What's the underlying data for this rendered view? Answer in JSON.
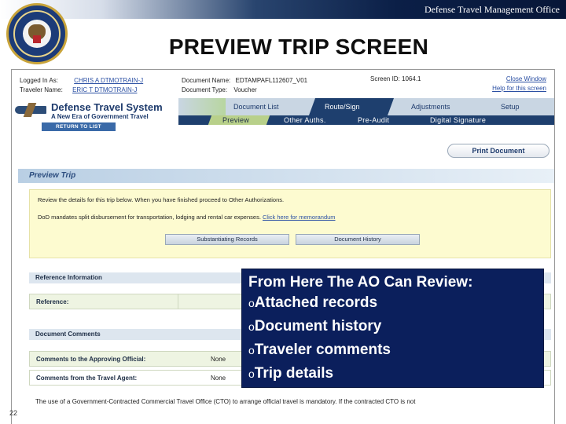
{
  "header": {
    "org_name": "Defense Travel Management Office",
    "slide_title": "PREVIEW TRIP SCREEN",
    "page_number": "22"
  },
  "session": {
    "logged_in_label": "Logged In As:",
    "logged_in_value": "CHRIS A DTMOTRAIN-J",
    "traveler_label": "Traveler Name:",
    "traveler_value": "ERIC T DTMOTRAIN-J",
    "doc_name_label": "Document Name:",
    "doc_name_value": "EDTAMPAFL112607_V01",
    "doc_type_label": "Document Type:",
    "doc_type_value": "Voucher",
    "screen_id_label": "Screen ID:",
    "screen_id_value": "1064.1",
    "close_window": "Close Window",
    "help_link": "Help for this screen"
  },
  "brand": {
    "title": "Defense Travel System",
    "subtitle": "A New Era of Government Travel"
  },
  "nav": {
    "tabs": [
      "Document List",
      "Route/Sign",
      "Adjustments",
      "Setup"
    ],
    "active_tab": "Route/Sign",
    "subtabs": [
      "Preview",
      "Other Auths.",
      "Pre-Audit",
      "Digital Signature"
    ],
    "active_subtab": "Preview",
    "return_button": "RETURN TO LIST"
  },
  "toolbar": {
    "print_button": "Print Document"
  },
  "preview": {
    "section_title": "Preview Trip",
    "instruction": "Review the details for this trip below. When you have finished proceed to Other Authorizations.",
    "mandate": "DoD mandates split disbursement for transportation, lodging and rental car expenses.",
    "memo_link": "Click here for memorandum",
    "btn_substantiating": "Substantiating Records",
    "btn_history": "Document History"
  },
  "reference": {
    "section_title": "Reference Information",
    "label": "Reference:",
    "value": ""
  },
  "comments": {
    "section_title": "Document Comments",
    "ao_label": "Comments to the Approving Official:",
    "ao_value": "None",
    "agent_label": "Comments from the Travel Agent:",
    "agent_value": "None"
  },
  "footnote": {
    "line1": "The use of a Government-Contracted Commercial Travel Office (CTO) to arrange official travel is mandatory. If the contracted CTO is not"
  },
  "callout": {
    "heading": "From Here  The AO Can Review:",
    "bullet_glyph": "o",
    "items": [
      "Attached records",
      "Document history",
      "Traveler comments",
      "Trip details"
    ]
  },
  "colors": {
    "callout_bg": "#0b1f5c",
    "nav_dark": "#1e3f6e",
    "notice_bg": "#fdfbd0"
  }
}
